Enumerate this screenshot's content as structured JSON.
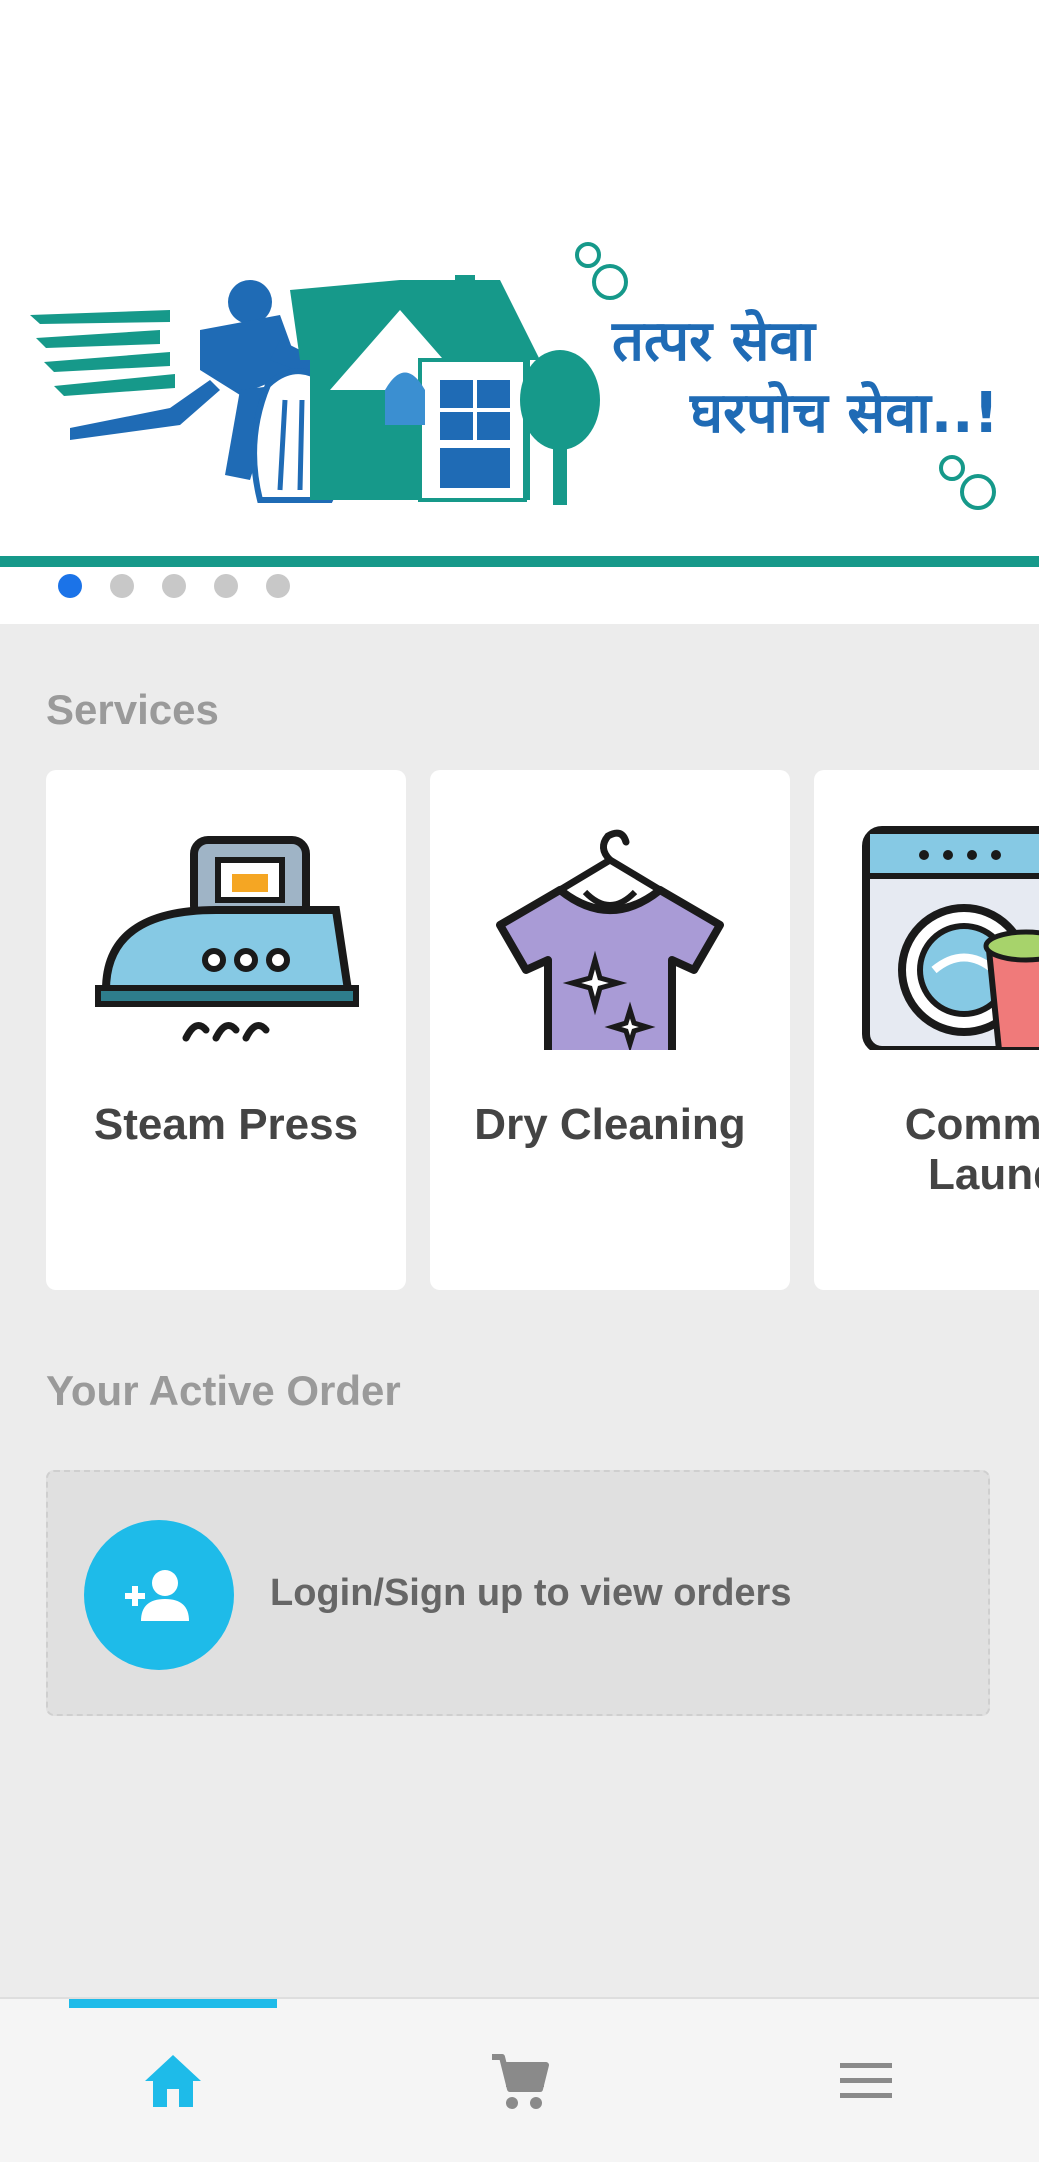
{
  "banner": {
    "tagline_line1": "तत्पर सेवा",
    "tagline_line2": "घरपोच सेवा..!",
    "carousel_dots": 5,
    "active_dot": 0,
    "colors": {
      "teal": "#16998a",
      "blue": "#1f6bb5"
    }
  },
  "services": {
    "title": "Services",
    "items": [
      {
        "label": "Steam Press",
        "icon": "steam-iron-icon"
      },
      {
        "label": "Dry Cleaning",
        "icon": "shirt-hanger-icon"
      },
      {
        "label": "Commer\nLaund",
        "icon": "washing-machine-icon"
      }
    ]
  },
  "active_order": {
    "title": "Your Active Order",
    "login_text": "Login/Sign up to view orders",
    "icon": "add-user-icon"
  },
  "bottom_nav": {
    "items": [
      {
        "name": "home",
        "icon": "home-icon",
        "active": true
      },
      {
        "name": "cart",
        "icon": "cart-icon",
        "active": false
      },
      {
        "name": "menu",
        "icon": "menu-icon",
        "active": false
      }
    ],
    "accent": "#1ebbe9"
  }
}
